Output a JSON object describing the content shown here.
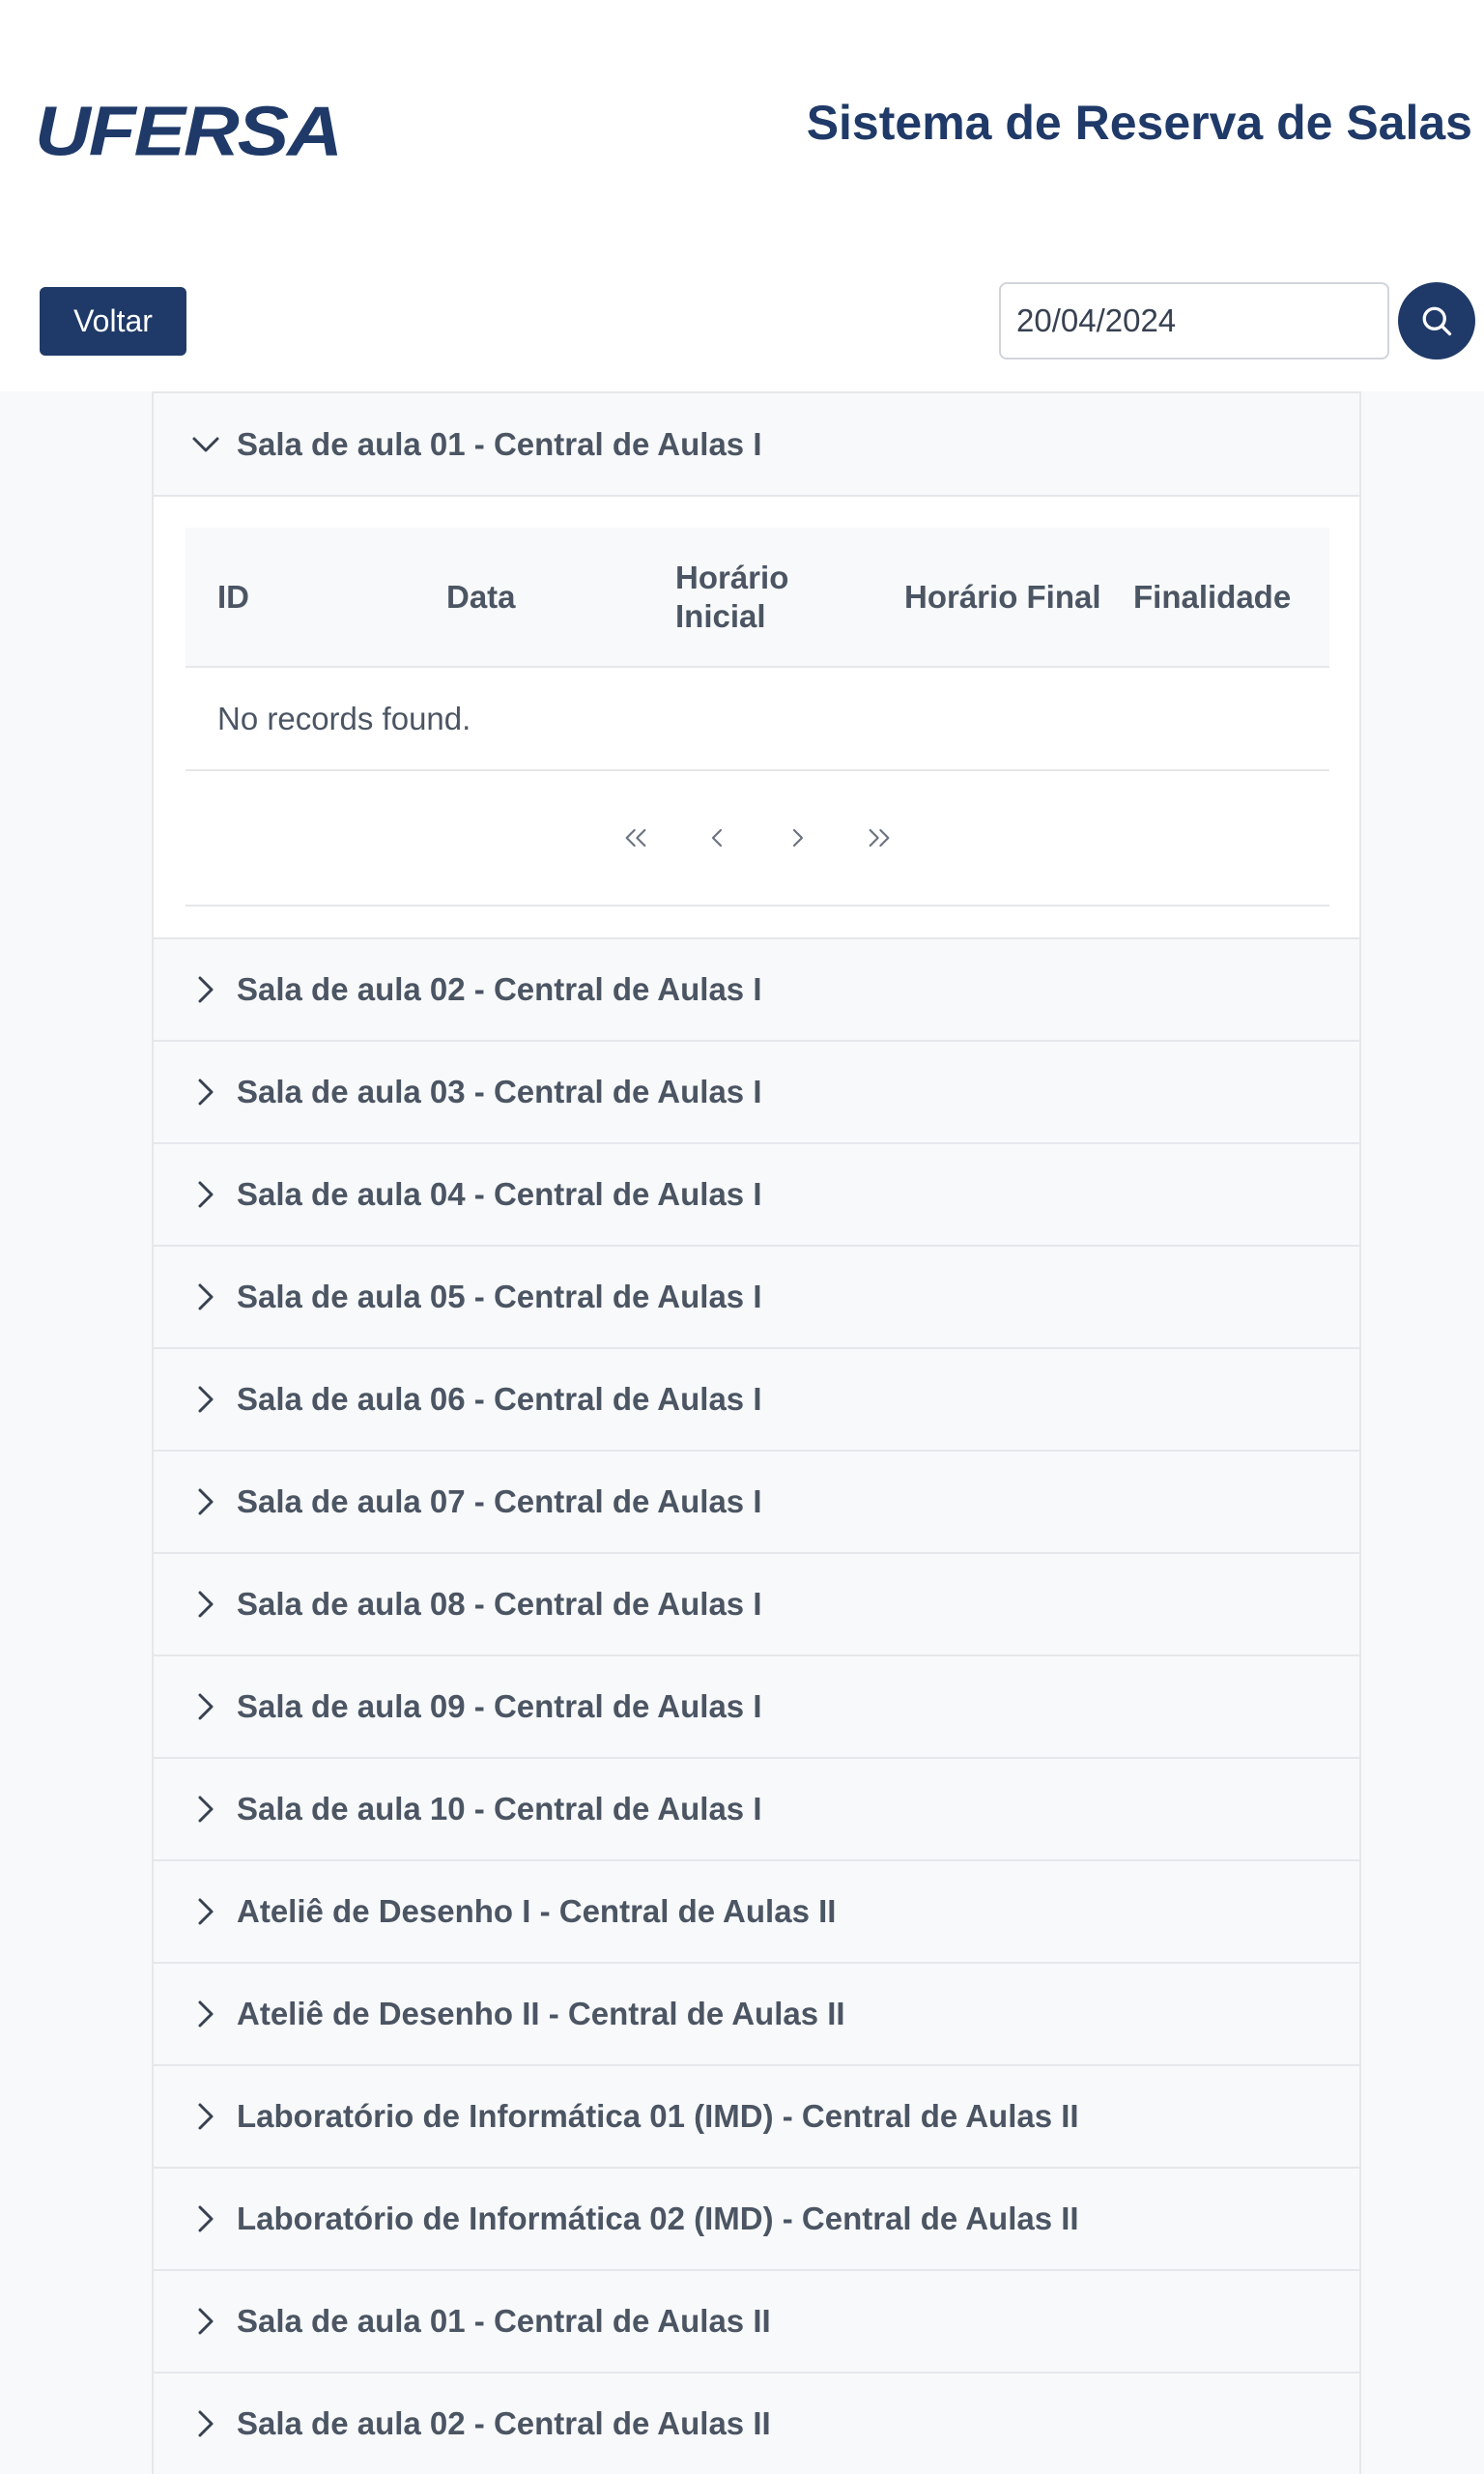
{
  "header": {
    "logo_text": "UFERSA",
    "app_title": "Sistema de Reserva de Salas"
  },
  "toolbar": {
    "back_label": "Voltar",
    "date_value": "20/04/2024",
    "search_icon": "search-icon"
  },
  "colors": {
    "brand": "#1f3a68",
    "panel_bg": "#f8f9fa",
    "text": "#4b5563",
    "border": "#e5e7eb"
  },
  "accordion": {
    "expanded": {
      "label": "Sala de aula 01 - Central de Aulas I",
      "table": {
        "columns": [
          "ID",
          "Data",
          "Horário Inicial",
          "Horário Final",
          "Finalidade"
        ],
        "empty_message": "No records found."
      },
      "paginator": {
        "icons": [
          "first-page-icon",
          "prev-page-icon",
          "next-page-icon",
          "last-page-icon"
        ]
      }
    },
    "items": [
      "Sala de aula 02 - Central de Aulas I",
      "Sala de aula 03 - Central de Aulas I",
      "Sala de aula 04 - Central de Aulas I",
      "Sala de aula 05 - Central de Aulas I",
      "Sala de aula 06 - Central de Aulas I",
      "Sala de aula 07 - Central de Aulas I",
      "Sala de aula 08 - Central de Aulas I",
      "Sala de aula 09 - Central de Aulas I",
      "Sala de aula 10 - Central de Aulas I",
      "Ateliê de Desenho I - Central de Aulas II",
      "Ateliê de Desenho II - Central de Aulas II",
      "Laboratório de Informática 01 (IMD) - Central de Aulas II",
      "Laboratório de Informática 02 (IMD) - Central de Aulas II",
      "Sala de aula 01 - Central de Aulas II",
      "Sala de aula 02 - Central de Aulas II"
    ]
  }
}
